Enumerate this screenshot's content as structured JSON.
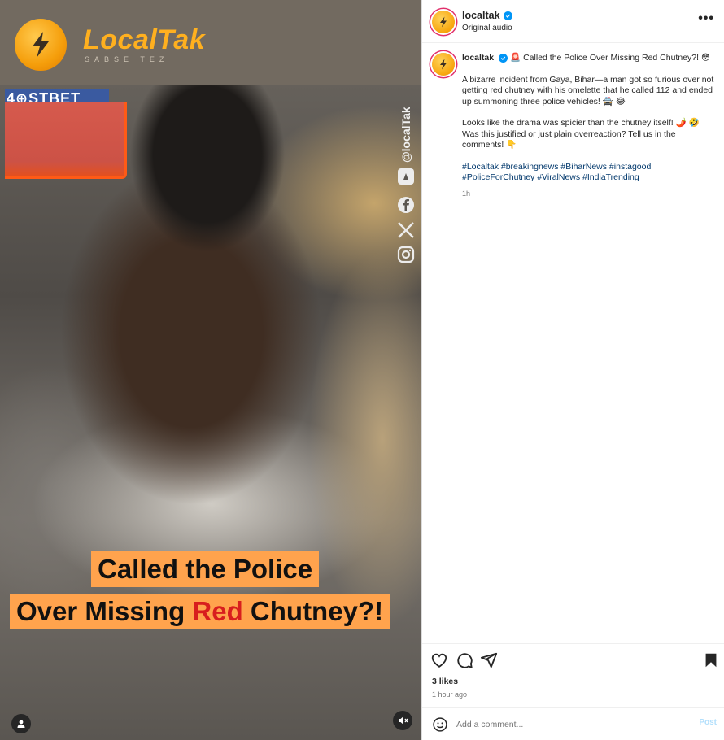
{
  "video": {
    "brand_name": "LocalTak",
    "brand_tagline": "SABSE TEZ",
    "sponsor_text": "4⊕STBET",
    "watermark_handle": "@localTak",
    "caption_line1": "Called the Police",
    "caption_line2_before": "Over Missing ",
    "caption_line2_highlight": "Red",
    "caption_line2_after": " Chutney?!",
    "icons": [
      "youtube-icon",
      "facebook-icon",
      "x-icon",
      "instagram-icon",
      "profile-icon",
      "mute-icon"
    ]
  },
  "post": {
    "header": {
      "username": "localtak",
      "audio": "Original audio",
      "more": "•••"
    },
    "caption": {
      "username": "localtak",
      "headline": "🚨 Called the Police Over Missing Red Chutney?! 😳",
      "paragraph1": "A bizarre incident from Gaya, Bihar—a man got so furious over not getting red chutney with his omelette that he called 112 and ended up summoning three police vehicles! 🚔 😂",
      "paragraph2": "Looks like the drama was spicier than the chutney itself! 🌶️ 🤣 Was this justified or just plain overreaction? Tell us in the comments! 👇",
      "hashtags": "#Localtak #breakingnews #BiharNews #instagood #PoliceForChutney #ViralNews #IndiaTrending",
      "time": "1h"
    },
    "likes": "3 likes",
    "age": "1 hour ago",
    "comment": {
      "placeholder": "Add a comment...",
      "post_label": "Post"
    }
  },
  "colors": {
    "brand_orange": "#ffb01f",
    "caption_bg": "#ffa34d",
    "highlight_red": "#d81e1e",
    "verified_blue": "#0095f6",
    "hashtag_blue": "#00376b",
    "post_button_disabled": "#b2dffc"
  }
}
